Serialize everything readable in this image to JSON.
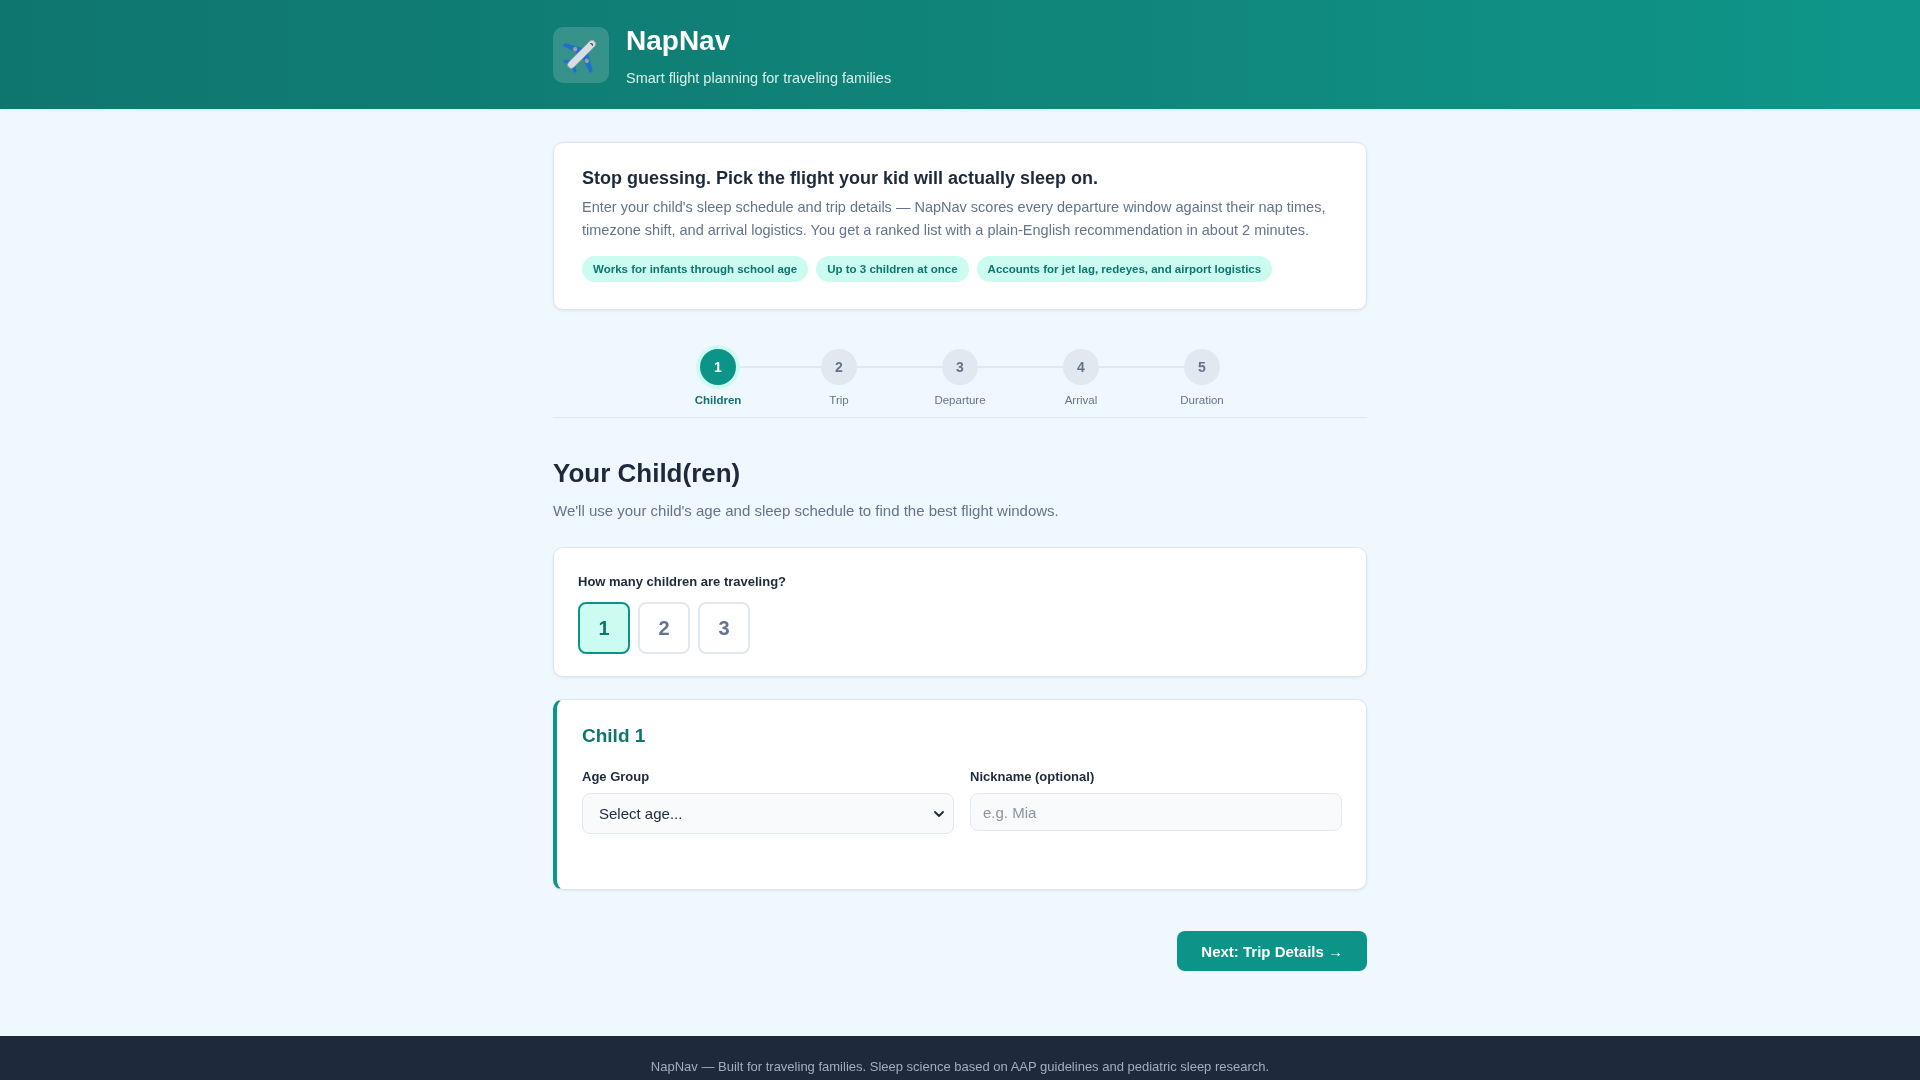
{
  "header": {
    "title": "NapNav",
    "tagline": "Smart flight planning for traveling families"
  },
  "intro": {
    "title": "Stop guessing. Pick the flight your kid will actually sleep on.",
    "body": "Enter your child's sleep schedule and trip details — NapNav scores every departure window against their nap times, timezone shift, and arrival logistics. You get a ranked list with a plain-English recommendation in about 2 minutes.",
    "tags": [
      "Works for infants through school age",
      "Up to 3 children at once",
      "Accounts for jet lag, redeyes, and airport logistics"
    ]
  },
  "steps": [
    {
      "number": "1",
      "label": "Children",
      "selected": true
    },
    {
      "number": "2",
      "label": "Trip",
      "selected": false
    },
    {
      "number": "3",
      "label": "Departure",
      "selected": false
    },
    {
      "number": "4",
      "label": "Arrival",
      "selected": false
    },
    {
      "number": "5",
      "label": "Duration",
      "selected": false
    }
  ],
  "section": {
    "title": "Your Child(ren)",
    "subtitle": "We'll use your child's age and sleep schedule to find the best flight windows."
  },
  "child_count": {
    "label": "How many children are traveling?",
    "options": [
      {
        "label": "1",
        "selected": true
      },
      {
        "label": "2",
        "selected": false
      },
      {
        "label": "3",
        "selected": false
      }
    ]
  },
  "children": [
    {
      "title": "Child 1",
      "fields": [
        {
          "kind": "select",
          "label": "Age Group",
          "value": "Select age..."
        },
        {
          "kind": "text",
          "label": "Nickname (optional)",
          "placeholder": "e.g. Mia"
        }
      ]
    }
  ],
  "next_button": "Next: Trip Details →",
  "footer": "NapNav — Built for traveling families. Sleep science based on AAP guidelines and pediatric sleep research."
}
